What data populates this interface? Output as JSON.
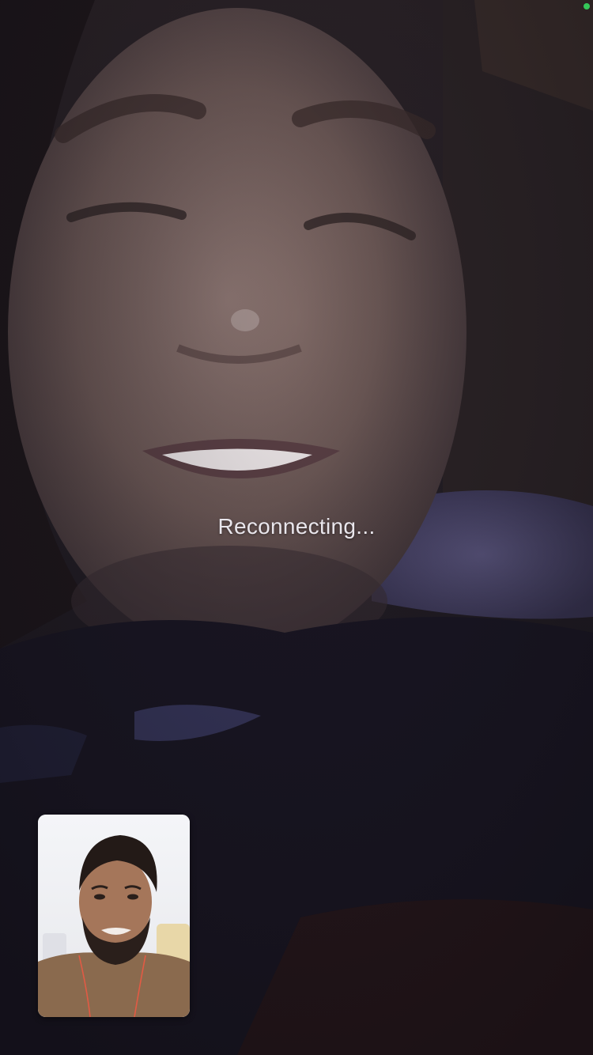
{
  "call": {
    "status_text": "Reconnecting...",
    "active_indicator_color": "#35c759"
  },
  "remote_video": {
    "icon": "remote-participant-video"
  },
  "self_view": {
    "icon": "self-view-camera"
  }
}
